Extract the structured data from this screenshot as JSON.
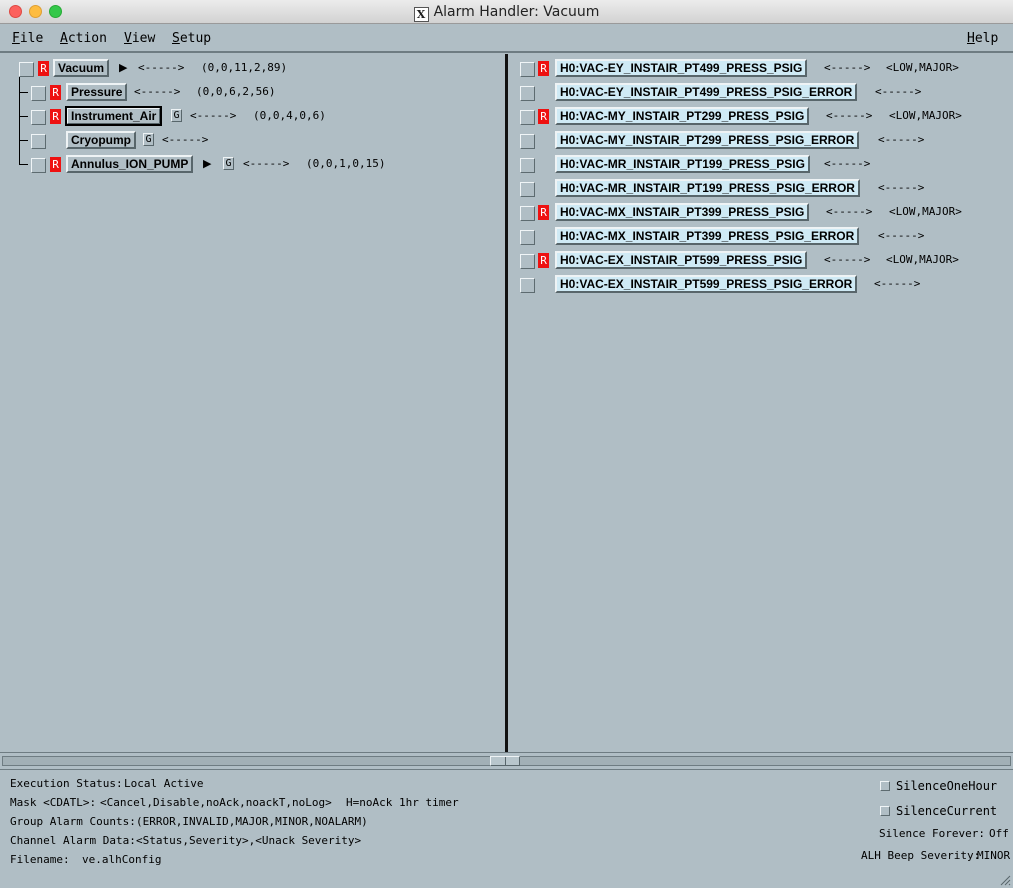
{
  "window": {
    "title": "Alarm Handler: Vacuum"
  },
  "menu": {
    "file": "File",
    "action": "Action",
    "view": "View",
    "setup": "Setup",
    "help": "Help"
  },
  "tree": [
    {
      "label": "Vacuum",
      "r": "R",
      "arrow": "<----->",
      "counts": "(0,0,11,2,89)"
    },
    {
      "label": "Pressure",
      "r": "R",
      "arrow": "<----->",
      "counts": "(0,0,6,2,56)"
    },
    {
      "label": "Instrument_Air",
      "r": "R",
      "g": "G",
      "arrow": "<----->",
      "counts": "(0,0,4,0,6)"
    },
    {
      "label": "Cryopump",
      "g": "G",
      "arrow": "<----->"
    },
    {
      "label": "Annulus_ION_PUMP",
      "r": "R",
      "g": "G",
      "arrow": "<----->",
      "counts": "(0,0,1,0,15)"
    }
  ],
  "channels": [
    {
      "label": "H0:VAC-EY_INSTAIR_PT499_PRESS_PSIG",
      "r": "R",
      "arrow": "<----->",
      "sev": "<LOW,MAJOR>"
    },
    {
      "label": "H0:VAC-EY_INSTAIR_PT499_PRESS_PSIG_ERROR",
      "arrow": "<----->"
    },
    {
      "label": "H0:VAC-MY_INSTAIR_PT299_PRESS_PSIG",
      "r": "R",
      "arrow": "<----->",
      "sev": "<LOW,MAJOR>"
    },
    {
      "label": "H0:VAC-MY_INSTAIR_PT299_PRESS_PSIG_ERROR",
      "arrow": "<----->"
    },
    {
      "label": "H0:VAC-MR_INSTAIR_PT199_PRESS_PSIG",
      "arrow": "<----->"
    },
    {
      "label": "H0:VAC-MR_INSTAIR_PT199_PRESS_PSIG_ERROR",
      "arrow": "<----->"
    },
    {
      "label": "H0:VAC-MX_INSTAIR_PT399_PRESS_PSIG",
      "r": "R",
      "arrow": "<----->",
      "sev": "<LOW,MAJOR>"
    },
    {
      "label": "H0:VAC-MX_INSTAIR_PT399_PRESS_PSIG_ERROR",
      "arrow": "<----->"
    },
    {
      "label": "H0:VAC-EX_INSTAIR_PT599_PRESS_PSIG",
      "r": "R",
      "arrow": "<----->",
      "sev": "<LOW,MAJOR>"
    },
    {
      "label": "H0:VAC-EX_INSTAIR_PT599_PRESS_PSIG_ERROR",
      "arrow": "<----->"
    }
  ],
  "status": {
    "exec_label": "Execution Status:",
    "exec_value": "Local Active",
    "mask_label": "Mask <CDATL>:",
    "mask_value": "<Cancel,Disable,noAck,noackT,noLog>",
    "mask_note": "H=noAck 1hr timer",
    "group_label": "Group Alarm Counts:",
    "group_value": "(ERROR,INVALID,MAJOR,MINOR,NOALARM)",
    "channel_label": "Channel Alarm Data:",
    "channel_value": "<Status,Severity>,<Unack Severity>",
    "file_label": "Filename:",
    "file_value": "ve.alhConfig",
    "silence_hour": "SilenceOneHour",
    "silence_current": "SilenceCurrent",
    "forever_label": "Silence Forever:",
    "forever_value": "Off",
    "beep_label": "ALH Beep Severity:",
    "beep_value": "MINOR"
  },
  "colors": {
    "background": "#b0bec5",
    "alarm_red": "#ee1111",
    "channel_highlight": "#cfeaf5"
  }
}
